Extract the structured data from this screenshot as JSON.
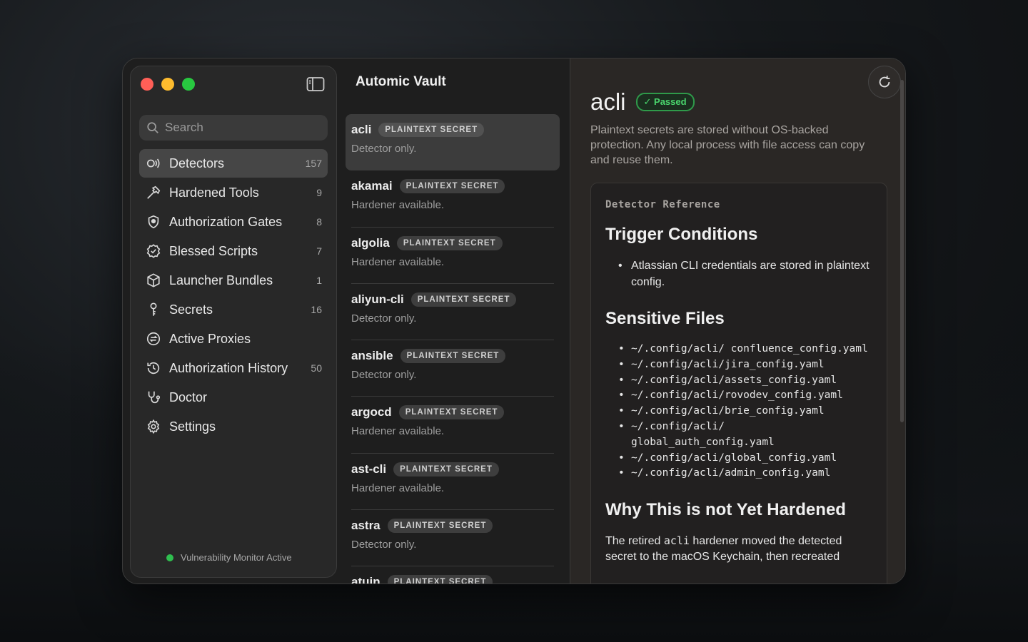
{
  "sidebar": {
    "search_placeholder": "Search",
    "items": [
      {
        "label": "Detectors",
        "count": "157"
      },
      {
        "label": "Hardened Tools",
        "count": "9"
      },
      {
        "label": "Authorization Gates",
        "count": "8"
      },
      {
        "label": "Blessed Scripts",
        "count": "7"
      },
      {
        "label": "Launcher Bundles",
        "count": "1"
      },
      {
        "label": "Secrets",
        "count": "16"
      },
      {
        "label": "Active Proxies",
        "count": ""
      },
      {
        "label": "Authorization History",
        "count": "50"
      },
      {
        "label": "Doctor",
        "count": ""
      },
      {
        "label": "Settings",
        "count": ""
      }
    ],
    "status": "Vulnerability Monitor Active"
  },
  "list": {
    "title": "Automic Vault",
    "rows": [
      {
        "name": "acli",
        "tag": "PLAINTEXT SECRET",
        "sub": "Detector only."
      },
      {
        "name": "akamai",
        "tag": "PLAINTEXT SECRET",
        "sub": "Hardener available."
      },
      {
        "name": "algolia",
        "tag": "PLAINTEXT SECRET",
        "sub": "Hardener available."
      },
      {
        "name": "aliyun-cli",
        "tag": "PLAINTEXT SECRET",
        "sub": "Detector only."
      },
      {
        "name": "ansible",
        "tag": "PLAINTEXT SECRET",
        "sub": "Detector only."
      },
      {
        "name": "argocd",
        "tag": "PLAINTEXT SECRET",
        "sub": "Hardener available."
      },
      {
        "name": "ast-cli",
        "tag": "PLAINTEXT SECRET",
        "sub": "Hardener available."
      },
      {
        "name": "astra",
        "tag": "PLAINTEXT SECRET",
        "sub": "Detector only."
      },
      {
        "name": "atuin",
        "tag": "PLAINTEXT SECRET",
        "sub": ""
      }
    ]
  },
  "detail": {
    "title": "acli",
    "badge": "✓ Passed",
    "description": "Plaintext secrets are stored without OS-backed protection. Any local process with file access can copy and reuse them.",
    "card_label": "Detector Reference",
    "trigger_heading": "Trigger Conditions",
    "trigger_items": [
      "Atlassian CLI credentials are stored in plaintext config."
    ],
    "files_heading": "Sensitive Files",
    "files": [
      "~/.config/acli/ confluence_config.yaml",
      "~/.config/acli/jira_config.yaml",
      "~/.config/acli/assets_config.yaml",
      "~/.config/acli/rovodev_config.yaml",
      "~/.config/acli/brie_config.yaml",
      "~/.config/acli/ global_auth_config.yaml",
      "~/.config/acli/global_config.yaml",
      "~/.config/acli/admin_config.yaml"
    ],
    "why_heading": "Why This is not Yet Hardened",
    "why_pre": "The retired ",
    "why_code": "acli",
    "why_post": " hardener moved the detected secret to the macOS Keychain, then recreated"
  },
  "colors": {
    "accent_green": "#2fbf4f",
    "close": "#ff5f57",
    "minimize": "#febc2e",
    "zoom": "#28c840"
  }
}
